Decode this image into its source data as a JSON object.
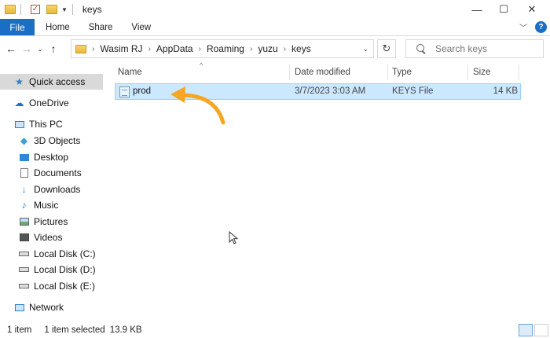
{
  "window": {
    "title": "keys",
    "controls": {
      "minimize": "—",
      "maximize": "☐",
      "close": "✕"
    }
  },
  "ribbon": {
    "file": "File",
    "tabs": [
      "Home",
      "Share",
      "View"
    ]
  },
  "address": {
    "crumbs": [
      "Wasim RJ",
      "AppData",
      "Roaming",
      "yuzu",
      "keys"
    ]
  },
  "search": {
    "placeholder": "Search keys"
  },
  "sidebar": {
    "quick_access": "Quick access",
    "onedrive": "OneDrive",
    "this_pc": "This PC",
    "items": [
      "3D Objects",
      "Desktop",
      "Documents",
      "Downloads",
      "Music",
      "Pictures",
      "Videos",
      "Local Disk (C:)",
      "Local Disk (D:)",
      "Local Disk (E:)"
    ],
    "network": "Network"
  },
  "columns": {
    "name": "Name",
    "date": "Date modified",
    "type": "Type",
    "size": "Size"
  },
  "files": [
    {
      "name": "prod",
      "date": "3/7/2023 3:03 AM",
      "type": "KEYS File",
      "size": "14 KB",
      "selected": true
    }
  ],
  "status": {
    "count": "1 item",
    "selected": "1 item selected",
    "size": "13.9 KB"
  },
  "colors": {
    "accent": "#1a6fc4",
    "selection": "#cce8ff",
    "arrow": "#f5a623"
  }
}
